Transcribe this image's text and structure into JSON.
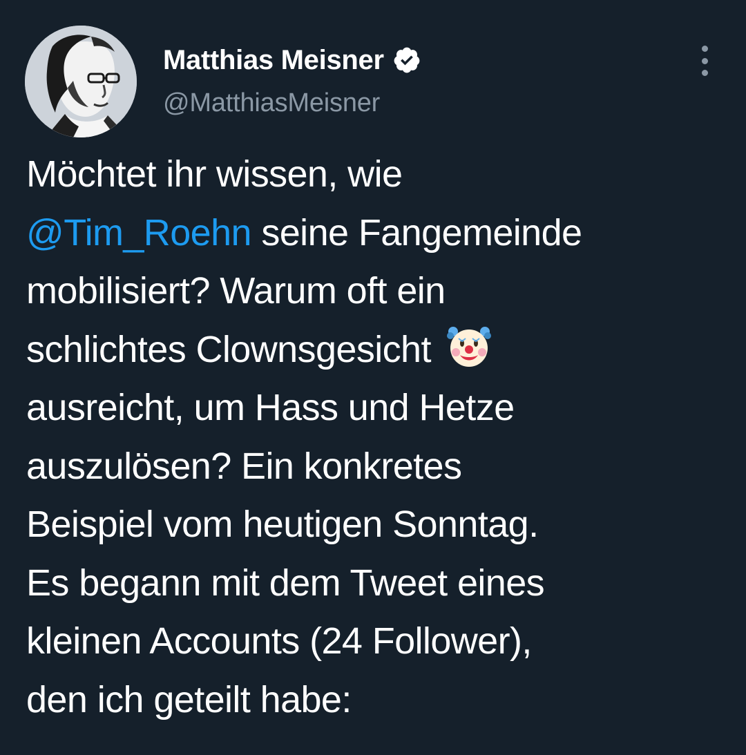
{
  "author": {
    "display_name": "Matthias Meisner",
    "handle": "@MatthiasMeisner",
    "verified": true
  },
  "tweet": {
    "lines": [
      {
        "text": "Möchtet ihr wissen, wie"
      },
      {
        "mention": "@Tim_Roehn",
        "text": " seine Fangemeinde"
      },
      {
        "text": "mobilisiert? Warum oft ein"
      },
      {
        "text": "schlichtes Clownsgesicht ",
        "emoji": "clown-face"
      },
      {
        "text": "ausreicht, um Hass und Hetze"
      },
      {
        "text": "auszulösen? Ein konkretes"
      },
      {
        "text": "Beispiel vom heutigen Sonntag."
      },
      {
        "text": "Es begann mit dem Tweet eines"
      },
      {
        "text": "kleinen Accounts (24 Follower),"
      },
      {
        "text": "den ich geteilt habe:"
      }
    ]
  },
  "icons": {
    "verified": "verified-badge-icon",
    "more": "more-options-icon",
    "emoji": "clown-face-emoji"
  },
  "colors": {
    "background": "#15202b",
    "text": "#ffffff",
    "secondary_text": "#8b98a5",
    "link": "#1d9bf0"
  }
}
